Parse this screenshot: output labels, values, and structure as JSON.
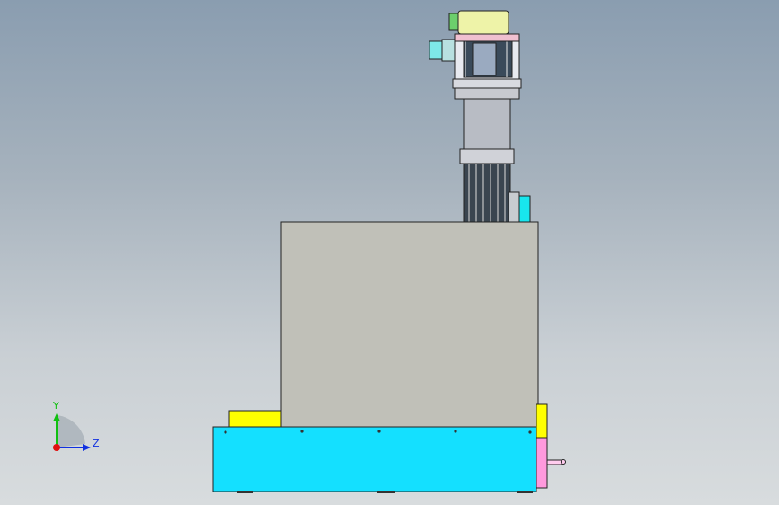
{
  "viewport": {
    "colors": {
      "background_top": "#8a9db0",
      "background_bottom": "#d8dcde",
      "base_plate": "#14e0ff",
      "housing": "#c0c0b8",
      "yellow_block": "#ffff00",
      "pink_block": "#ff99dd",
      "cyan_block": "#18e6ee",
      "motor_ring": "#eef0a0",
      "connector_green": "#66dd66",
      "connector_cyan": "#66eeee"
    },
    "triad": {
      "y_label": "Y",
      "z_label": "Z",
      "x_color": "#e01010",
      "y_color": "#10c010",
      "z_color": "#1030e0"
    }
  }
}
